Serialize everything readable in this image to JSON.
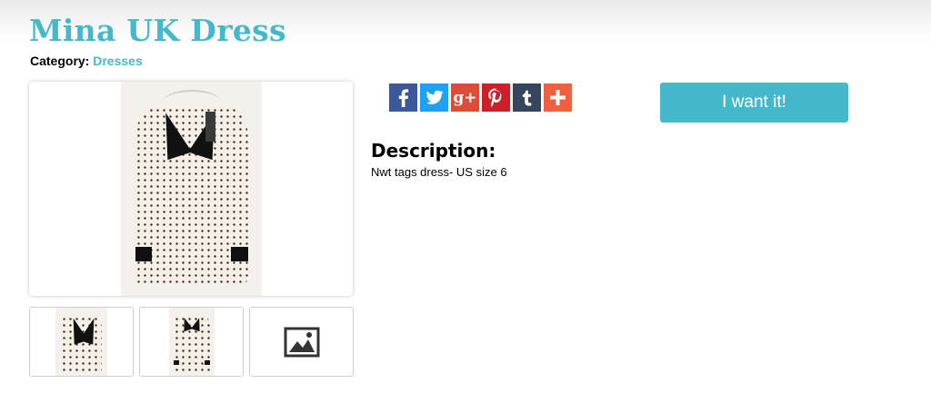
{
  "product": {
    "title": "Mina UK Dress",
    "category_label": "Category:",
    "category_value": "Dresses"
  },
  "gallery": {
    "main_image_alt": "Mina UK Dress photo",
    "thumbnails": [
      {
        "kind": "photo",
        "alt": "Dress collar close-up"
      },
      {
        "kind": "photo",
        "alt": "Dress full view"
      },
      {
        "kind": "placeholder",
        "icon": "image-placeholder-icon"
      }
    ]
  },
  "share": {
    "buttons": [
      {
        "network": "facebook",
        "glyph": "f",
        "color": "#3b5998"
      },
      {
        "network": "twitter",
        "glyph": "t",
        "color": "#1da1f2"
      },
      {
        "network": "google-plus",
        "glyph": "g+",
        "color": "#dd4b39"
      },
      {
        "network": "pinterest",
        "glyph": "p",
        "color": "#cb2027"
      },
      {
        "network": "tumblr",
        "glyph": "t",
        "color": "#35465c"
      },
      {
        "network": "more",
        "glyph": "+",
        "color": "#f05f40"
      }
    ]
  },
  "actions": {
    "want_label": "I want it!",
    "accent_color": "#45b9cb"
  },
  "description": {
    "heading": "Description:",
    "text": "Nwt tags dress- US size 6"
  }
}
